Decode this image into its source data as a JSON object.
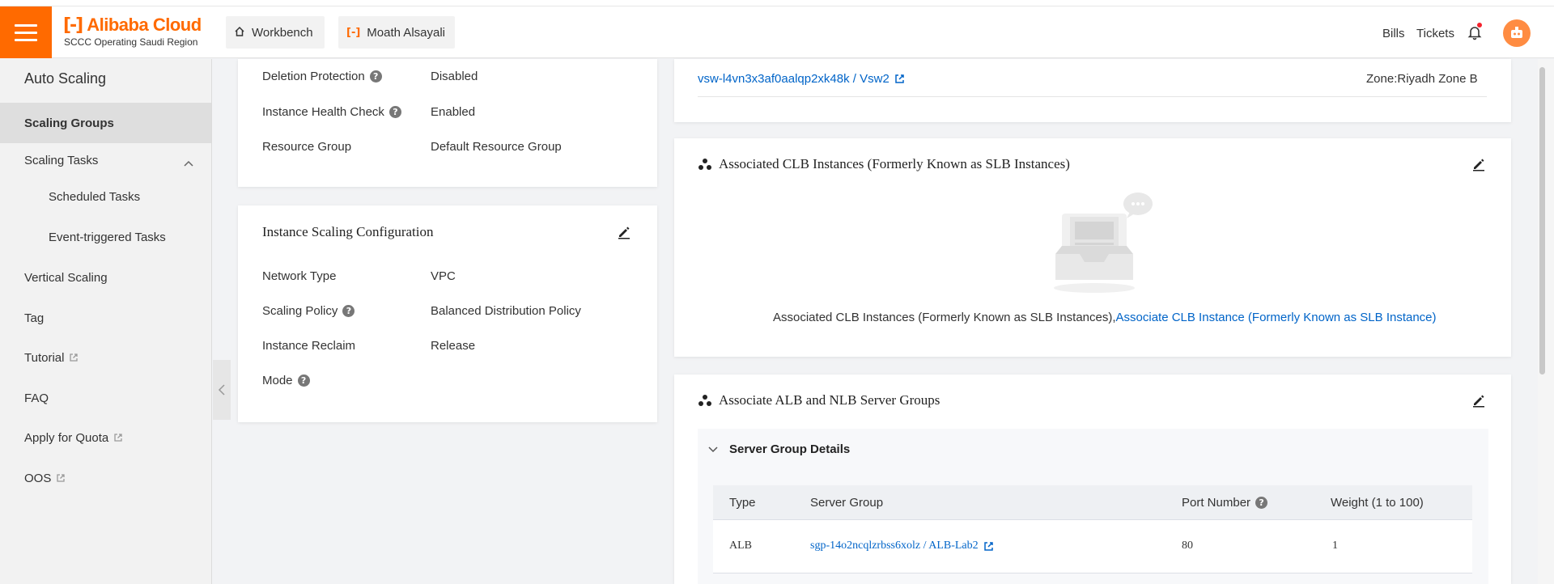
{
  "topbar": {
    "logo_text": "Alibaba Cloud",
    "region": "SCCC Operating Saudi Region",
    "workbench": "Workbench",
    "account": "Moath Alsayali",
    "bills": "Bills",
    "tickets": "Tickets",
    "brand_color": "#ff6a00"
  },
  "sidebar": {
    "title": "Auto Scaling",
    "items": [
      {
        "label": "Scaling Groups"
      },
      {
        "label": "Scaling Tasks"
      },
      {
        "label": "Scheduled Tasks"
      },
      {
        "label": "Event-triggered Tasks"
      },
      {
        "label": "Vertical Scaling"
      },
      {
        "label": "Tag"
      },
      {
        "label": "Tutorial"
      },
      {
        "label": "FAQ"
      },
      {
        "label": "Apply for Quota"
      },
      {
        "label": "OOS"
      }
    ]
  },
  "basic": {
    "deletion_protection_label": "Deletion Protection",
    "deletion_protection_value": "Disabled",
    "health_check_label": "Instance Health Check",
    "health_check_value": "Enabled",
    "resource_group_label": "Resource Group",
    "resource_group_value": "Default Resource Group"
  },
  "scaling_config": {
    "title": "Instance Scaling Configuration",
    "network_type_label": "Network Type",
    "network_type_value": "VPC",
    "scaling_policy_label": "Scaling Policy",
    "scaling_policy_value": "Balanced Distribution Policy",
    "reclaim_label": "Instance Reclaim",
    "reclaim_value": "Release",
    "mode_label": "Mode"
  },
  "vswitch": {
    "link": "vsw-l4vn3x3af0aalqp2xk48k / Vsw2",
    "zone": "Zone:Riyadh Zone B"
  },
  "clb": {
    "title": "Associated CLB Instances (Formerly Known as SLB Instances)",
    "empty_text": "Associated CLB Instances (Formerly Known as SLB Instances),",
    "empty_link": "Associate CLB Instance (Formerly Known as SLB Instance)"
  },
  "alb": {
    "title": "Associate ALB and NLB Server Groups",
    "details_title": "Server Group Details",
    "headers": {
      "type": "Type",
      "server_group": "Server Group",
      "port": "Port Number",
      "weight": "Weight (1 to 100)"
    },
    "rows": [
      {
        "type": "ALB",
        "server_group": "sgp-14o2ncqlzrbss6xolz / ALB-Lab2",
        "port": "80",
        "weight": "1"
      }
    ]
  }
}
